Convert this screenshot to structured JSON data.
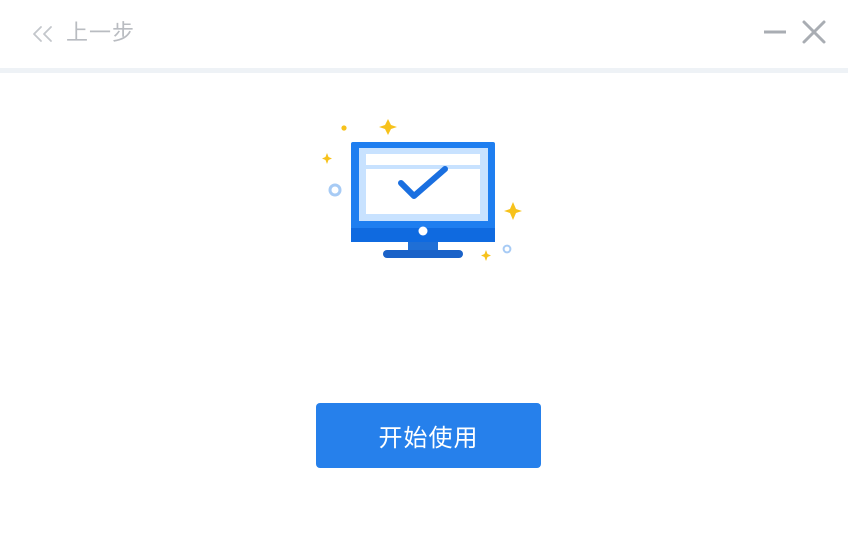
{
  "header": {
    "back_label": "上一步",
    "back_icon": "double-chevron-left-icon",
    "minimize_icon": "minimize-icon",
    "close_icon": "close-icon"
  },
  "main": {
    "illustration": "monitor-check-icon",
    "start_button_label": "开始使用"
  },
  "colors": {
    "primary": "#2680eb",
    "muted_text": "#b9bcc1",
    "sparkle": "#f7c21b"
  }
}
